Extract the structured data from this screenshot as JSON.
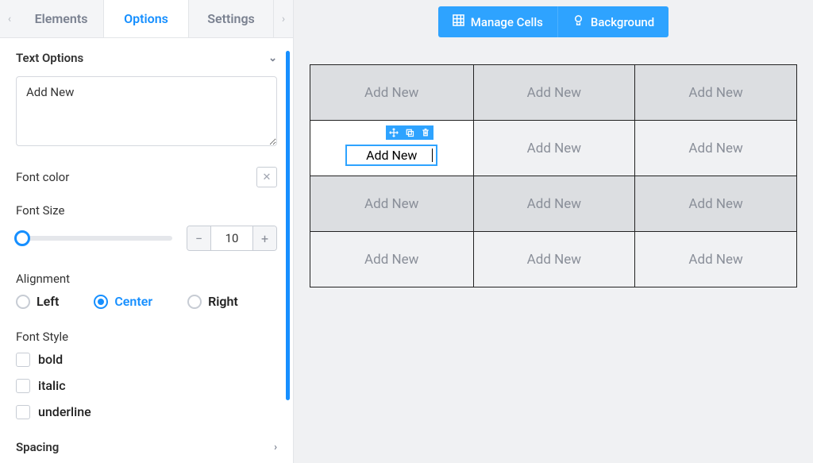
{
  "tabs": {
    "items": [
      "Elements",
      "Options",
      "Settings"
    ],
    "active": 1
  },
  "textOptions": {
    "header": "Text Options",
    "value": "Add New",
    "fontColor": {
      "label": "Font color"
    },
    "fontSize": {
      "label": "Font Size",
      "value": "10"
    },
    "alignment": {
      "label": "Alignment",
      "options": [
        "Left",
        "Center",
        "Right"
      ],
      "selected": 1
    },
    "fontStyle": {
      "label": "Font Style",
      "options": [
        "bold",
        "italic",
        "underline"
      ]
    },
    "spacing": {
      "label": "Spacing"
    }
  },
  "toolbar": {
    "manage": "Manage Cells",
    "background": "Background"
  },
  "grid": {
    "cellLabel": "Add New",
    "selected": {
      "row": 1,
      "col": 0,
      "value": "Add New"
    }
  }
}
